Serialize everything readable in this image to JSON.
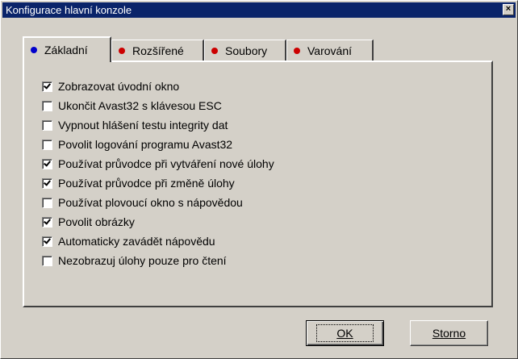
{
  "window": {
    "title": "Konfigurace hlavní konzole",
    "close_glyph": "×"
  },
  "tabs": [
    {
      "label": "Základní",
      "dot_color": "#0000cc",
      "active": true
    },
    {
      "label": "Rozšířené",
      "dot_color": "#cc0000",
      "active": false
    },
    {
      "label": "Soubory",
      "dot_color": "#cc0000",
      "active": false
    },
    {
      "label": "Varování",
      "dot_color": "#cc0000",
      "active": false
    }
  ],
  "options": [
    {
      "label": "Zobrazovat úvodní okno",
      "checked": true
    },
    {
      "label": "Ukončit Avast32 s klávesou ESC",
      "checked": false
    },
    {
      "label": "Vypnout hlášení testu integrity dat",
      "checked": false
    },
    {
      "label": "Povolit logování programu Avast32",
      "checked": false
    },
    {
      "label": "Používat průvodce při vytváření nové úlohy",
      "checked": true
    },
    {
      "label": "Používat průvodce při změně úlohy",
      "checked": true
    },
    {
      "label": "Používat plovoucí okno s nápovědou",
      "checked": false
    },
    {
      "label": "Povolit obrázky",
      "checked": true
    },
    {
      "label": "Automaticky zavádět nápovědu",
      "checked": true
    },
    {
      "label": "Nezobrazuj úlohy pouze pro čtení",
      "checked": false
    }
  ],
  "buttons": {
    "ok_label": "OK",
    "cancel_label": "Storno"
  }
}
